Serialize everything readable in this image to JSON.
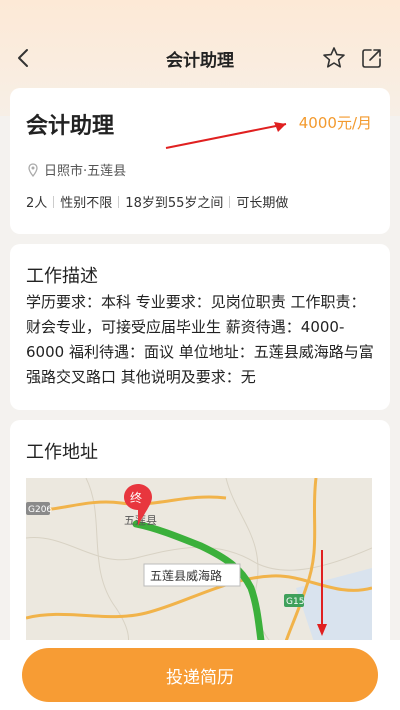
{
  "header": {
    "title": "会计助理"
  },
  "job": {
    "title": "会计助理",
    "salary": "4000元/月",
    "location": "日照市·五莲县",
    "tags": [
      "2人",
      "性别不限",
      "18岁到55岁之间",
      "可长期做"
    ]
  },
  "description": {
    "title": "工作描述",
    "text": "学历要求：本科 专业要求：见岗位职责 工作职责：财会专业，可接受应届毕业生 薪资待遇：4000-6000 福利待遇：面议 单位地址：五莲县威海路与富强路交叉路口 其他说明及要求：无"
  },
  "address": {
    "title": "工作地址",
    "map": {
      "marker_label": "终",
      "road_label": "五莲县威海路",
      "place_label": "五莲县",
      "highway_g206": "G206",
      "highway_g15": "G15"
    }
  },
  "bottom": {
    "apply_label": "投递简历"
  },
  "colors": {
    "accent": "#f79c34",
    "salary": "#f39a2e",
    "route": "#3bb03b",
    "annotation": "#e02020"
  }
}
